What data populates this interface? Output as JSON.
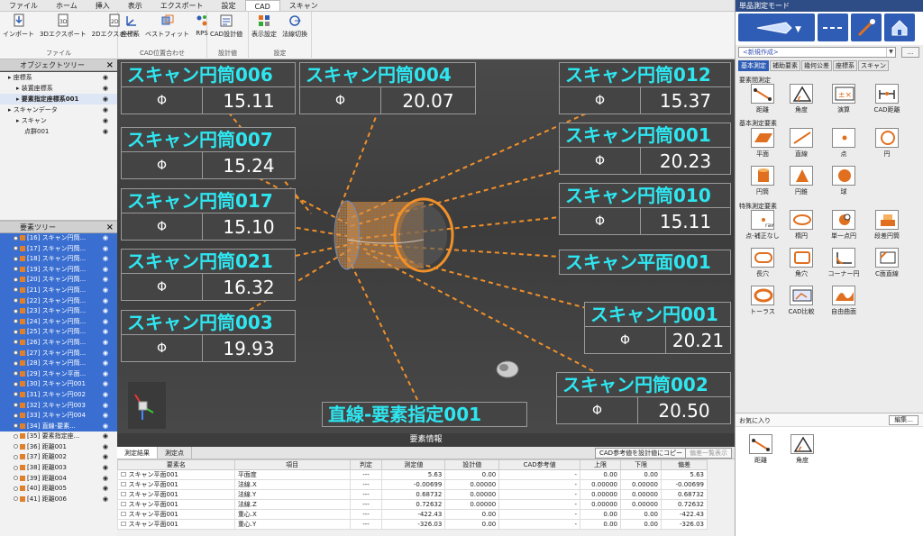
{
  "menu": [
    "ファイル",
    "ホーム",
    "挿入",
    "表示",
    "エクスポート",
    "設定",
    "CAD",
    "スキャン"
  ],
  "ribbon": {
    "groups": [
      {
        "label": "ファイル",
        "buttons": [
          "インポート",
          "3Dエクスポート",
          "2Dエクスポート"
        ]
      },
      {
        "label": "CAD位置合わせ",
        "buttons": [
          "座標系",
          "ベストフィット",
          "RPS"
        ]
      },
      {
        "label": "設計値",
        "buttons": [
          "CAD設計値"
        ]
      },
      {
        "label": "設定",
        "buttons": [
          "表示設定",
          "法線切換"
        ]
      }
    ]
  },
  "object_tree": {
    "title": "オブジェクトツリー",
    "rows": [
      {
        "label": "座標系",
        "indent": 1
      },
      {
        "label": "装置座標系",
        "indent": 2
      },
      {
        "label": "要素指定座標系001",
        "indent": 2,
        "bold": true
      },
      {
        "label": "スキャンデータ",
        "indent": 1
      },
      {
        "label": "スキャン",
        "indent": 2
      },
      {
        "label": "点群001",
        "indent": 3
      }
    ]
  },
  "element_tree": {
    "title": "要素ツリー",
    "rows": [
      {
        "label": "[16] スキャン円筒...",
        "sel": true
      },
      {
        "label": "[17] スキャン円筒...",
        "sel": true
      },
      {
        "label": "[18] スキャン円筒...",
        "sel": true
      },
      {
        "label": "[19] スキャン円筒...",
        "sel": true
      },
      {
        "label": "[20] スキャン円筒...",
        "sel": true
      },
      {
        "label": "[21] スキャン円筒...",
        "sel": true
      },
      {
        "label": "[22] スキャン円筒...",
        "sel": true
      },
      {
        "label": "[23] スキャン円筒...",
        "sel": true
      },
      {
        "label": "[24] スキャン円筒...",
        "sel": true
      },
      {
        "label": "[25] スキャン円筒...",
        "sel": true
      },
      {
        "label": "[26] スキャン円筒...",
        "sel": true
      },
      {
        "label": "[27] スキャン円筒...",
        "sel": true
      },
      {
        "label": "[28] スキャン円筒...",
        "sel": true
      },
      {
        "label": "[29] スキャン平面...",
        "sel": true
      },
      {
        "label": "[30] スキャン円001",
        "sel": true
      },
      {
        "label": "[31] スキャン円002",
        "sel": true
      },
      {
        "label": "[32] スキャン円003",
        "sel": true
      },
      {
        "label": "[33] スキャン円004",
        "sel": true
      },
      {
        "label": "[34] 直線-要素...",
        "sel": true
      },
      {
        "label": "[35] 要素指定座...",
        "sel": false
      },
      {
        "label": "[36] 距離001",
        "sel": false
      },
      {
        "label": "[37] 距離002",
        "sel": false
      },
      {
        "label": "[38] 距離003",
        "sel": false
      },
      {
        "label": "[39] 距離004",
        "sel": false
      },
      {
        "label": "[40] 距離005",
        "sel": false
      },
      {
        "label": "[41] 距離006",
        "sel": false
      }
    ]
  },
  "labels": [
    {
      "name": "スキャン円筒006",
      "value": "15.11"
    },
    {
      "name": "スキャン円筒004",
      "value": "20.07"
    },
    {
      "name": "スキャン円筒012",
      "value": "15.37"
    },
    {
      "name": "スキャン円筒007",
      "value": "15.24"
    },
    {
      "name": "スキャン円筒001",
      "value": "20.23"
    },
    {
      "name": "スキャン円筒017",
      "value": "15.10"
    },
    {
      "name": "スキャン円筒010",
      "value": "15.11"
    },
    {
      "name": "スキャン平面001",
      "value": ""
    },
    {
      "name": "スキャン円筒021",
      "value": "16.32"
    },
    {
      "name": "スキャン円001",
      "value": "20.21"
    },
    {
      "name": "スキャン円筒003",
      "value": "19.93"
    },
    {
      "name": "スキャン円筒002",
      "value": "20.50"
    },
    {
      "name": "直線-要素指定001",
      "value": ""
    }
  ],
  "diameter_symbol": "Φ",
  "info": {
    "title": "要素情報",
    "tabs": [
      "測定結果",
      "測定点"
    ],
    "btn_cad": "CAD参考値を設計値にコピー",
    "btn_list": "偏差一覧表示",
    "headers": [
      "要素名",
      "項目",
      "判定",
      "測定値",
      "設計値",
      "CAD参考値",
      "上限",
      "下限",
      "偏差"
    ],
    "rows": [
      [
        "スキャン平面001",
        "平面度",
        "---",
        "5.63",
        "0.00",
        "-",
        "0.00",
        "0.00",
        "5.63"
      ],
      [
        "スキャン平面001",
        "法線.X",
        "---",
        "-0.00699",
        "0.00000",
        "-",
        "0.00000",
        "0.00000",
        "-0.00699"
      ],
      [
        "スキャン平面001",
        "法線.Y",
        "---",
        "0.68732",
        "0.00000",
        "-",
        "0.00000",
        "0.00000",
        "0.68732"
      ],
      [
        "スキャン平面001",
        "法線.Z",
        "---",
        "0.72632",
        "0.00000",
        "-",
        "0.00000",
        "0.00000",
        "0.72632"
      ],
      [
        "スキャン平面001",
        "重心.X",
        "---",
        "-422.43",
        "0.00",
        "-",
        "0.00",
        "0.00",
        "-422.43"
      ],
      [
        "スキャン平面001",
        "重心.Y",
        "---",
        "-326.03",
        "0.00",
        "-",
        "0.00",
        "0.00",
        "-326.03"
      ]
    ]
  },
  "right_panel": {
    "title": "単品測定モード",
    "combo": "<新規作成>",
    "more": "...",
    "tabs": [
      "基本測定",
      "補助要素",
      "幾何公差",
      "座標系",
      "スキャン"
    ],
    "sections": [
      "要素間測定",
      "基本測定要素",
      "特殊測定要素"
    ],
    "tools_inter": [
      "距離",
      "角度",
      "演算",
      "CAD距離"
    ],
    "tools_basic": [
      "平面",
      "直線",
      "点",
      "円",
      "円筒",
      "円錐",
      "球"
    ],
    "tools_special": [
      "点-補正なし",
      "楕円",
      "単一点円",
      "段差円筒",
      "長穴",
      "角穴",
      "コーナー円",
      "C面直線",
      "トーラス",
      "CAD比較",
      "自由曲面"
    ],
    "fav_title": "お気に入り",
    "fav_edit": "編集...",
    "fav_tools": [
      "距離",
      "角度"
    ]
  },
  "colors": {
    "label_text": "#2ee6f0",
    "accent": "#2f5db5",
    "orange": "#f0902a",
    "selection": "#3a6fd1"
  }
}
